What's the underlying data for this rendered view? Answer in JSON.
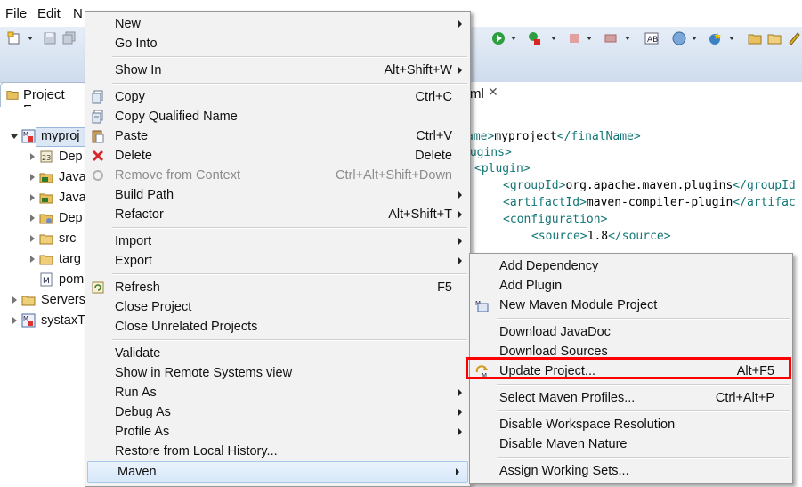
{
  "menubar": {
    "items": [
      "File",
      "Edit",
      "N"
    ]
  },
  "project_explorer": {
    "tab_label": "Project Exp",
    "tree": [
      {
        "label": "myproj",
        "expanded": true,
        "selected": true,
        "icon": "maven-project-icon"
      },
      {
        "label": "Dep",
        "icon": "library-icon"
      },
      {
        "label": "Java",
        "icon": "java-source-icon"
      },
      {
        "label": "Java",
        "icon": "java-source-icon"
      },
      {
        "label": "Dep",
        "icon": "dependency-folder-icon"
      },
      {
        "label": "src",
        "icon": "folder-icon"
      },
      {
        "label": "targ",
        "icon": "folder-icon"
      },
      {
        "label": "pom",
        "icon": "maven-file-icon",
        "leaf": true
      },
      {
        "label": "Servers",
        "icon": "folder-icon"
      },
      {
        "label": "systaxT",
        "icon": "maven-project-icon"
      }
    ]
  },
  "editor": {
    "tab_label": "ml",
    "code": [
      {
        "tag_open": "ame>",
        "text": "myproject",
        "tag_close": "</finalName>"
      },
      {
        "tag_open": "lugins>",
        "text": "",
        "tag_close": ""
      },
      {
        "tag_open": "<plugin>",
        "text": "",
        "tag_close": ""
      },
      {
        "tag_open": "<groupId>",
        "text": "org.apache.maven.plugins",
        "tag_close": "</groupId"
      },
      {
        "tag_open": "<artifactId>",
        "text": "maven-compiler-plugin",
        "tag_close": "</artifac"
      },
      {
        "tag_open": "<configuration>",
        "text": "",
        "tag_close": ""
      },
      {
        "tag_open": "<source>",
        "text": "1.8",
        "tag_close": "</source>"
      }
    ]
  },
  "context_menu": {
    "items": [
      {
        "label": "New",
        "submenu": true
      },
      {
        "label": "Go Into"
      },
      {
        "separator": true
      },
      {
        "label": "Show In",
        "accel": "Alt+Shift+W",
        "submenu": true
      },
      {
        "separator": true
      },
      {
        "label": "Copy",
        "accel": "Ctrl+C",
        "icon": "copy-icon"
      },
      {
        "label": "Copy Qualified Name",
        "icon": "copy-qualified-icon"
      },
      {
        "label": "Paste",
        "accel": "Ctrl+V",
        "icon": "paste-icon"
      },
      {
        "label": "Delete",
        "accel": "Delete",
        "icon": "delete-icon"
      },
      {
        "label": "Remove from Context",
        "accel": "Ctrl+Alt+Shift+Down",
        "disabled": true,
        "icon": "remove-context-icon"
      },
      {
        "label": "Build Path",
        "submenu": true
      },
      {
        "label": "Refactor",
        "accel": "Alt+Shift+T",
        "submenu": true
      },
      {
        "separator": true
      },
      {
        "label": "Import",
        "submenu": true
      },
      {
        "label": "Export",
        "submenu": true
      },
      {
        "separator": true
      },
      {
        "label": "Refresh",
        "accel": "F5",
        "icon": "refresh-icon"
      },
      {
        "label": "Close Project"
      },
      {
        "label": "Close Unrelated Projects"
      },
      {
        "separator": true
      },
      {
        "label": "Validate"
      },
      {
        "label": "Show in Remote Systems view"
      },
      {
        "label": "Run As",
        "submenu": true
      },
      {
        "label": "Debug As",
        "submenu": true
      },
      {
        "label": "Profile As",
        "submenu": true
      },
      {
        "label": "Restore from Local History..."
      },
      {
        "label": "Maven",
        "submenu": true,
        "highlighted": true
      }
    ]
  },
  "maven_submenu": {
    "items": [
      {
        "label": "Add Dependency"
      },
      {
        "label": "Add Plugin"
      },
      {
        "label": "New Maven Module Project",
        "icon": "maven-module-icon"
      },
      {
        "separator": true
      },
      {
        "label": "Download JavaDoc"
      },
      {
        "label": "Download Sources"
      },
      {
        "label": "Update Project...",
        "accel": "Alt+F5",
        "icon": "update-project-icon",
        "emphasized": true
      },
      {
        "separator": true
      },
      {
        "label": "Select Maven Profiles...",
        "accel": "Ctrl+Alt+P"
      },
      {
        "separator": true
      },
      {
        "label": "Disable Workspace Resolution"
      },
      {
        "label": "Disable Maven Nature"
      },
      {
        "separator": true
      },
      {
        "label": "Assign Working Sets..."
      }
    ]
  },
  "colors": {
    "menu_bg": "#f2f2f2",
    "highlight": "#d6e8fa",
    "emphasis_border": "#ff0000",
    "xml_tag": "#137575"
  }
}
